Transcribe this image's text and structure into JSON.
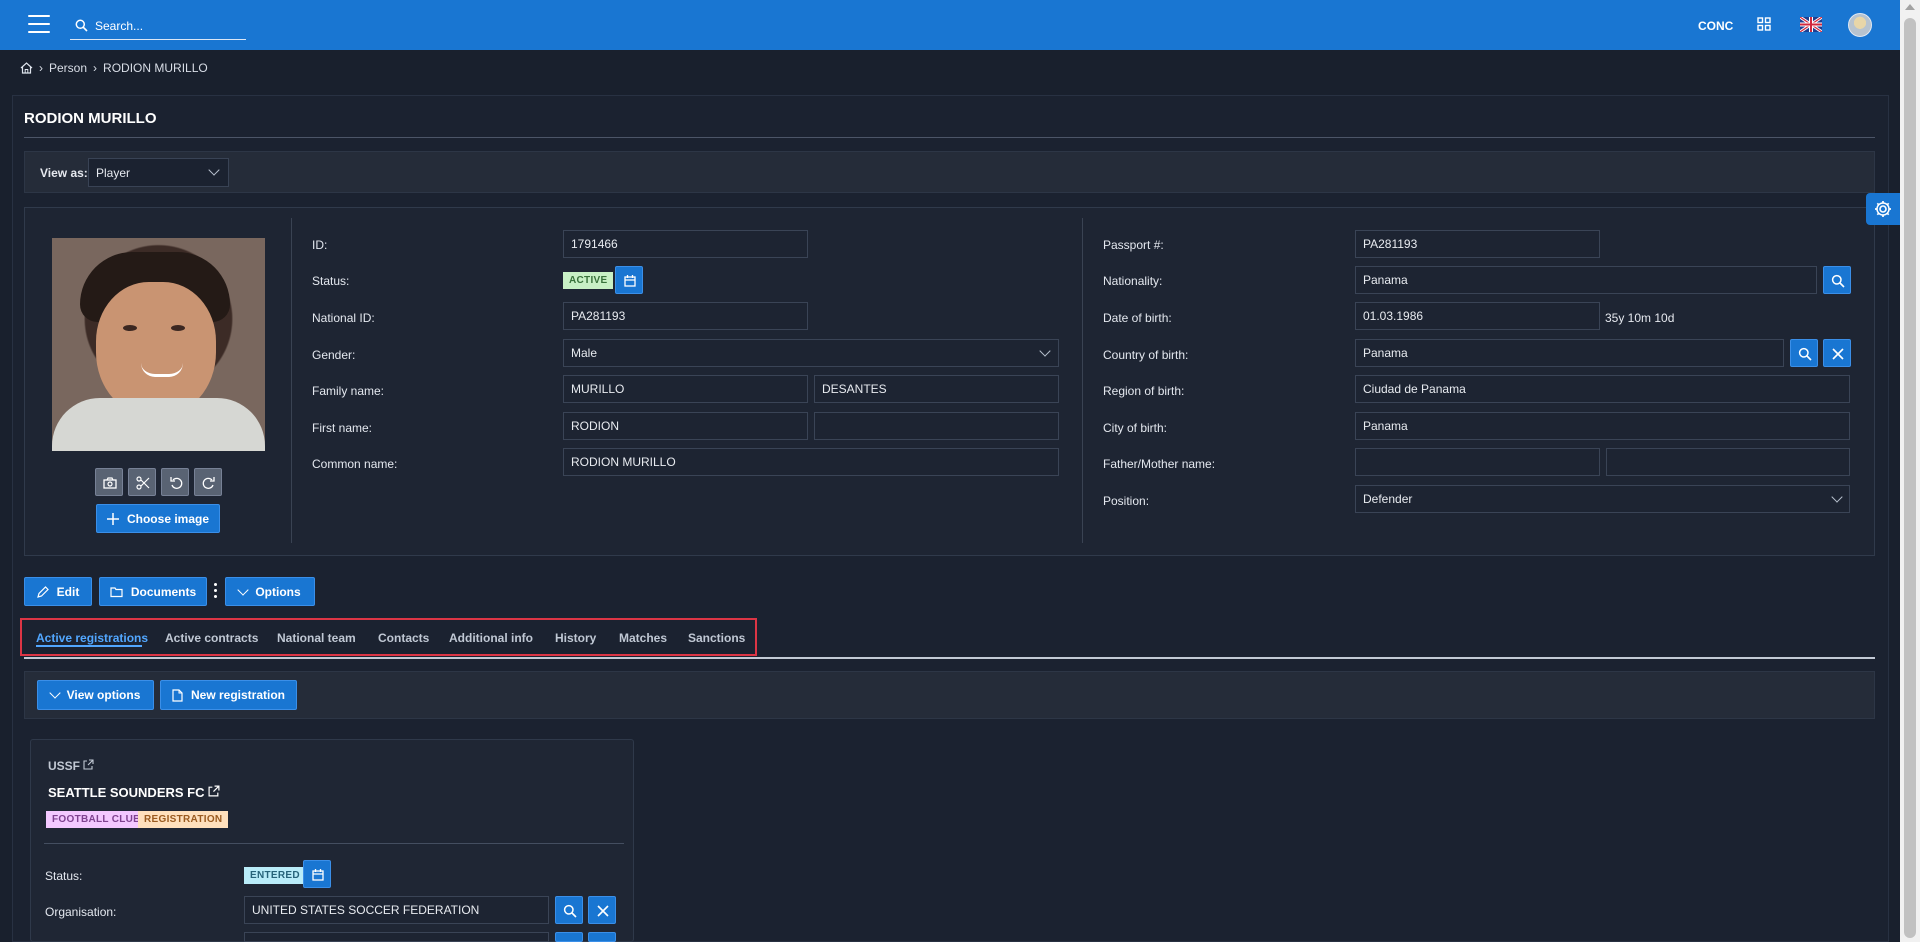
{
  "header": {
    "search_placeholder": "Search...",
    "org_code": "CONC",
    "icons": [
      "menu-icon",
      "search-icon",
      "apps-icon",
      "uk-flag-icon",
      "avatar"
    ]
  },
  "breadcrumb": {
    "items": [
      "Person",
      "RODION MURILLO"
    ]
  },
  "page": {
    "title": "RODION MURILLO",
    "view_as_label": "View as:",
    "view_as_value": "Player"
  },
  "person": {
    "id_label": "ID:",
    "id": "1791466",
    "status_label": "Status:",
    "status": "ACTIVE",
    "national_id_label": "National ID:",
    "national_id": "PA281193",
    "gender_label": "Gender:",
    "gender": "Male",
    "family_name_label": "Family name:",
    "family_name_1": "MURILLO",
    "family_name_2": "DESANTES",
    "first_name_label": "First name:",
    "first_name_1": "RODION",
    "first_name_2": "",
    "common_name_label": "Common name:",
    "common_name": "RODION MURILLO",
    "passport_label": "Passport #:",
    "passport": "PA281193",
    "nationality_label": "Nationality:",
    "nationality": "Panama",
    "dob_label": "Date of birth:",
    "dob": "01.03.1986",
    "age": "35y 10m 10d",
    "country_birth_label": "Country of birth:",
    "country_birth": "Panama",
    "region_birth_label": "Region of birth:",
    "region_birth": "Ciudad de Panama",
    "city_birth_label": "City of birth:",
    "city_birth": "Panama",
    "parent_name_label": "Father/Mother name:",
    "parent_name_1": "",
    "parent_name_2": "",
    "position_label": "Position:",
    "position": "Defender"
  },
  "image_tools": {
    "choose_image": "Choose image"
  },
  "actions": {
    "edit": "Edit",
    "documents": "Documents",
    "options": "Options"
  },
  "tabs": [
    "Active registrations",
    "Active contracts",
    "National team",
    "Contacts",
    "Additional info",
    "History",
    "Matches",
    "Sanctions"
  ],
  "registrations": {
    "view_options": "View options",
    "new_registration": "New registration",
    "association": "USSF",
    "club": "SEATTLE SOUNDERS FC",
    "tags": [
      "FOOTBALL CLUB",
      "REGISTRATION"
    ],
    "status_label": "Status:",
    "status": "ENTERED",
    "organisation_label": "Organisation:",
    "organisation": "UNITED STATES SOCCER FEDERATION"
  },
  "colors": {
    "accent": "#1976d2",
    "active_tab": "#52a7ff",
    "active_badge": "#c8f0c5",
    "entered_badge": "#b9ecf9",
    "club_tag": "#f3c8ff",
    "registration_tag": "#ffe0bd",
    "highlight": "#dc3545"
  }
}
